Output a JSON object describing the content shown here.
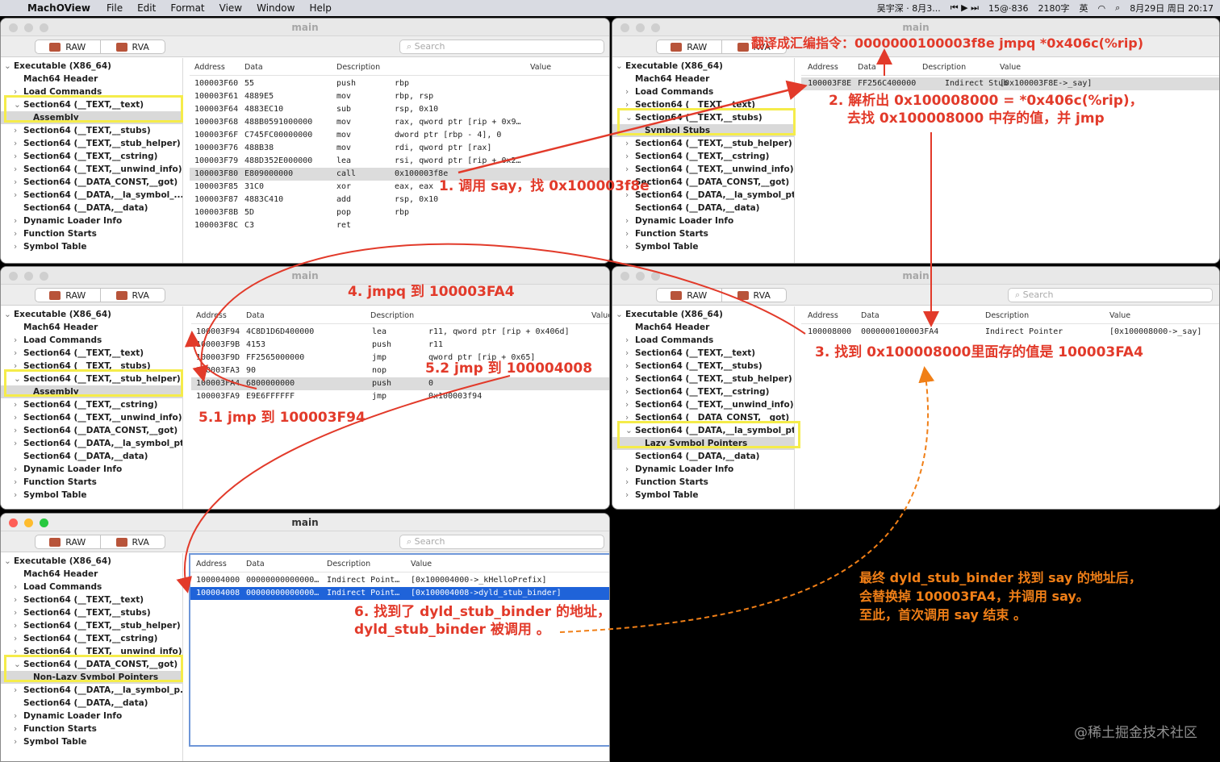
{
  "menubar": {
    "app": "MachOView",
    "menus": [
      "File",
      "Edit",
      "Format",
      "View",
      "Window",
      "Help"
    ],
    "status": [
      "吴宇深 · 8月3...",
      "15@·836",
      "2180字",
      "英",
      "8月29日 周日 20:17"
    ]
  },
  "window_title": "main",
  "seg": {
    "raw": "RAW",
    "rva": "RVA"
  },
  "search_placeholder": "Search",
  "cols": {
    "address": "Address",
    "data": "Data",
    "description": "Description",
    "value": "Value"
  },
  "w1": {
    "side": [
      "Executable  (X86_64)",
      "Mach64 Header",
      "Load Commands",
      "Section64 (__TEXT,__text)",
      "Assembly",
      "Section64 (__TEXT,__stubs)",
      "Section64 (__TEXT,__stub_helper)",
      "Section64 (__TEXT,__cstring)",
      "Section64 (__TEXT,__unwind_info)",
      "Section64 (__DATA_CONST,__got)",
      "Section64 (__DATA,__la_symbol_...",
      "Section64 (__DATA,__data)",
      "Dynamic Loader Info",
      "Function Starts",
      "Symbol Table"
    ],
    "rows": [
      [
        "100003F60",
        "55",
        "push",
        "rbp"
      ],
      [
        "100003F61",
        "4889E5",
        "mov",
        "rbp, rsp"
      ],
      [
        "100003F64",
        "4883EC10",
        "sub",
        "rsp, 0x10"
      ],
      [
        "100003F68",
        "488B0591000000",
        "mov",
        "rax, qword ptr [rip + 0x9…"
      ],
      [
        "100003F6F",
        "C745FC00000000",
        "mov",
        "dword ptr [rbp - 4], 0"
      ],
      [
        "100003F76",
        "488B38",
        "mov",
        "rdi, qword ptr [rax]"
      ],
      [
        "100003F79",
        "488D352E000000",
        "lea",
        "rsi, qword ptr [rip + 0x2…"
      ],
      [
        "100003F80",
        "E809000000",
        "call",
        "0x100003f8e"
      ],
      [
        "100003F85",
        "31C0",
        "xor",
        "eax, eax"
      ],
      [
        "100003F87",
        "4883C410",
        "add",
        "rsp, 0x10"
      ],
      [
        "100003F8B",
        "5D",
        "pop",
        "rbp"
      ],
      [
        "100003F8C",
        "C3",
        "ret",
        ""
      ]
    ]
  },
  "w2": {
    "side": [
      "Executable  (X86_64)",
      "Mach64 Header",
      "Load Commands",
      "Section64 (__TEXT,__text)",
      "Section64 (__TEXT,__stubs)",
      "Symbol Stubs",
      "Section64 (__TEXT,__stub_helper)",
      "Section64 (__TEXT,__cstring)",
      "Section64 (__TEXT,__unwind_info)",
      "Section64 (__DATA_CONST,__got)",
      "Section64 (__DATA,__la_symbol_ptr)",
      "Section64 (__DATA,__data)",
      "Dynamic Loader Info",
      "Function Starts",
      "Symbol Table"
    ],
    "row": [
      "100003F8E",
      "FF256C400000",
      "Indirect Stub",
      "[0x100003F8E->_say]"
    ]
  },
  "w3": {
    "side": [
      "Executable  (X86_64)",
      "Mach64 Header",
      "Load Commands",
      "Section64 (__TEXT,__text)",
      "Section64 (__TEXT,__stubs)",
      "Section64 (__TEXT,__stub_helper)",
      "Assembly",
      "Section64 (__TEXT,__cstring)",
      "Section64 (__TEXT,__unwind_info)",
      "Section64 (__DATA_CONST,__got)",
      "Section64 (__DATA,__la_symbol_ptr)",
      "Section64 (__DATA,__data)",
      "Dynamic Loader Info",
      "Function Starts",
      "Symbol Table"
    ],
    "rows": [
      [
        "100003F94",
        "4C8D1D6D400000",
        "lea",
        "r11, qword ptr [rip + 0x406d]"
      ],
      [
        "100003F9B",
        "4153",
        "push",
        "r11"
      ],
      [
        "100003F9D",
        "FF2565000000",
        "jmp",
        "qword ptr [rip + 0x65]"
      ],
      [
        "100003FA3",
        "90",
        "nop",
        ""
      ],
      [
        "100003FA4",
        "6800000000",
        "push",
        "0"
      ],
      [
        "100003FA9",
        "E9E6FFFFFF",
        "jmp",
        "0x100003f94"
      ]
    ]
  },
  "w4": {
    "side": [
      "Executable  (X86_64)",
      "Mach64 Header",
      "Load Commands",
      "Section64 (__TEXT,__text)",
      "Section64 (__TEXT,__stubs)",
      "Section64 (__TEXT,__stub_helper)",
      "Section64 (__TEXT,__cstring)",
      "Section64 (__TEXT,__unwind_info)",
      "Section64 (__DATA_CONST,__got)",
      "Section64 (__DATA,__la_symbol_ptr)",
      "Lazy Symbol Pointers",
      "Section64 (__DATA,__data)",
      "Dynamic Loader Info",
      "Function Starts",
      "Symbol Table"
    ],
    "row": [
      "100008000",
      "0000000100003FA4",
      "Indirect Pointer",
      "[0x100008000->_say]"
    ]
  },
  "w5": {
    "side": [
      "Executable  (X86_64)",
      "Mach64 Header",
      "Load Commands",
      "Section64 (__TEXT,__text)",
      "Section64 (__TEXT,__stubs)",
      "Section64 (__TEXT,__stub_helper)",
      "Section64 (__TEXT,__cstring)",
      "Section64 (__TEXT,__unwind_info)",
      "Section64 (__DATA_CONST,__got)",
      "Non-Lazy Symbol Pointers",
      "Section64 (__DATA,__la_symbol_p...",
      "Section64 (__DATA,__data)",
      "Dynamic Loader Info",
      "Function Starts",
      "Symbol Table"
    ],
    "rows": [
      [
        "100004000",
        "00000000000000…",
        "Indirect Point…",
        "[0x100004000->_kHelloPrefix]"
      ],
      [
        "100004008",
        "00000000000000…",
        "Indirect Point…",
        "[0x100004008->dyld_stub_binder]"
      ]
    ]
  },
  "ann": {
    "a0": "翻译成汇编指令：0000000100003f8e jmpq  *0x406c(%rip)",
    "a1": "1. 调用 say，找 0x100003f8e",
    "a2a": "2. 解析出 0x100008000 = *0x406c(%rip)，",
    "a2b": "去找 0x100008000 中存的值，并 jmp",
    "a3": "3. 找到 0x100008000里面存的值是 100003FA4",
    "a4": "4. jmpq 到 100003FA4",
    "a51": "5.1 jmp 到 100003F94",
    "a52": "5.2 jmp 到 100004008",
    "a6a": "6. 找到了 dyld_stub_binder 的地址，",
    "a6b": "dyld_stub_binder 被调用 。",
    "a7a": "最终 dyld_stub_binder 找到 say 的地址后，",
    "a7b": "会替换掉 100003FA4，并调用 say。",
    "a7c": "至此，首次调用 say 结束 。"
  },
  "watermark": "@稀土掘金技术社区",
  "colors": {
    "annotation": "#e23a2a",
    "final_note": "#f07f17",
    "highlight": "#f5ec4a",
    "selection": "#1f63d9"
  }
}
